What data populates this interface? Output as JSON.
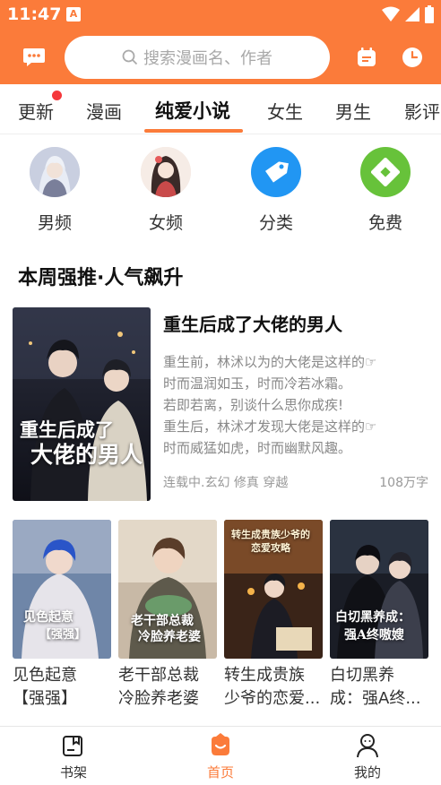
{
  "status_bar": {
    "time": "11:47",
    "app_badge": "A"
  },
  "header": {
    "search_placeholder": "搜索漫画名、作者"
  },
  "tabs": [
    {
      "label": "更新",
      "active": false,
      "has_dot": true
    },
    {
      "label": "漫画",
      "active": false
    },
    {
      "label": "纯爱小说",
      "active": true
    },
    {
      "label": "女生",
      "active": false
    },
    {
      "label": "男生",
      "active": false
    },
    {
      "label": "影评",
      "active": false
    }
  ],
  "categories": [
    {
      "label": "男频",
      "icon": "male-avatar"
    },
    {
      "label": "女频",
      "icon": "female-avatar"
    },
    {
      "label": "分类",
      "icon": "tag-icon",
      "color": "#2196f3"
    },
    {
      "label": "免费",
      "icon": "free-icon",
      "color": "#67c23a"
    }
  ],
  "section_title": "本周强推·人气飙升",
  "featured": {
    "title": "重生后成了大佬的男人",
    "description_lines": [
      "重生前，林沭以为的大佬是这样的☞",
      "时而温润如玉，时而冷若冰霜。",
      "若即若离，别谈什么思你成疾!",
      "重生后，林沭才发现大佬是这样的☞",
      "时而威猛如虎，时而幽默风趣。"
    ],
    "meta": "连载中.玄幻 修真 穿越",
    "word_count": "108万字",
    "cover_text_line1": "重生后成了",
    "cover_text_line2": "大佬的男人"
  },
  "grid": [
    {
      "title_line1": "见色起意",
      "title_line2": "【强强】",
      "cover_text": "见色起意\n【强强】"
    },
    {
      "title_line1": "老干部总裁",
      "title_line2": "冷脸养老婆",
      "cover_text": "老干部总裁\n冷脸养老婆"
    },
    {
      "title_line1": "转生成贵族",
      "title_line2": "少爷的恋爱...",
      "cover_text": "转生成贵族少爷的\n恋爱攻略"
    },
    {
      "title_line1": "白切黑养",
      "title_line2": "成：强A终...",
      "cover_text": "白切黑养成：\n强A终嗷嫂"
    }
  ],
  "bottom_nav": [
    {
      "label": "书架",
      "active": false
    },
    {
      "label": "首页",
      "active": true
    },
    {
      "label": "我的",
      "active": false
    }
  ],
  "colors": {
    "brand": "#fb7b3a",
    "dot": "#f5383b"
  }
}
